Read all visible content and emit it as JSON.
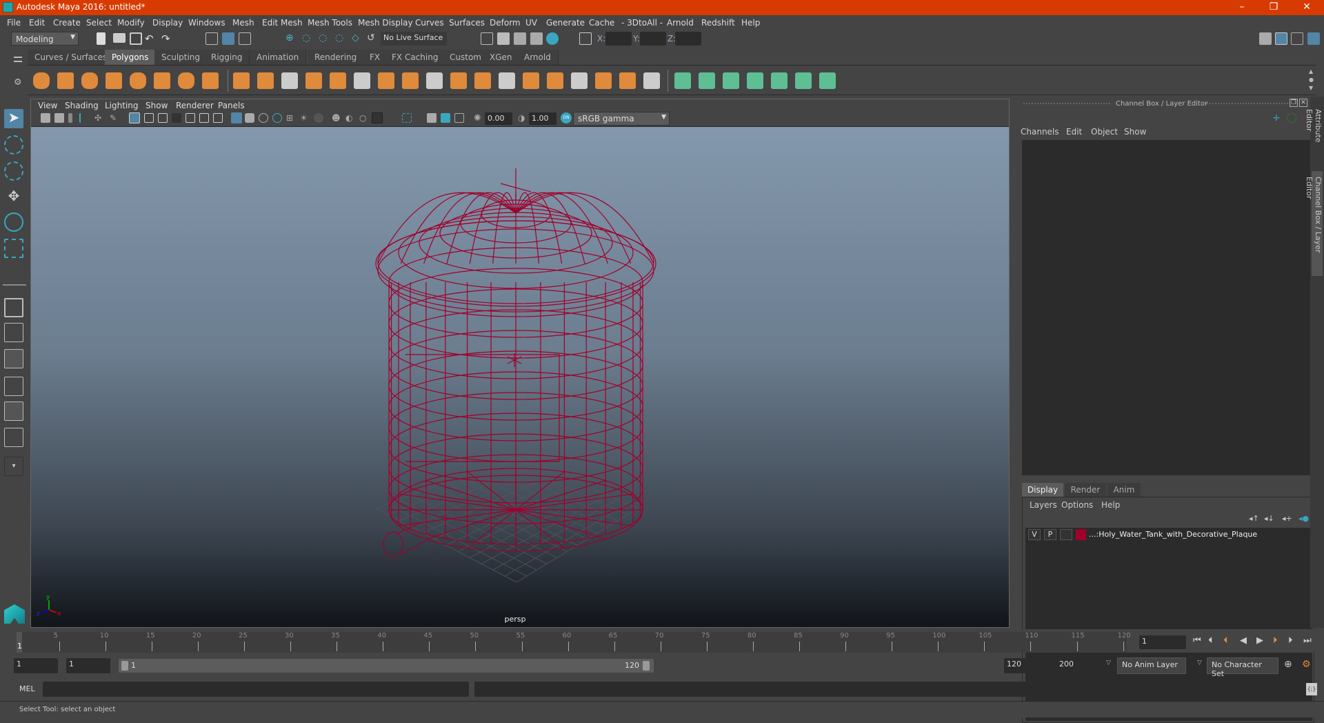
{
  "window": {
    "title": "Autodesk Maya 2016: untitled*",
    "minimize": "–",
    "restore": "❐",
    "close": "✕"
  },
  "menubar": [
    "File",
    "Edit",
    "Create",
    "Select",
    "Modify",
    "Display",
    "Windows",
    "Mesh",
    "Edit Mesh",
    "Mesh Tools",
    "Mesh Display",
    "Curves",
    "Surfaces",
    "Deform",
    "UV",
    "Generate",
    "Cache",
    "- 3DtoAll -",
    "Arnold",
    "Redshift",
    "Help"
  ],
  "statusline": {
    "mode": "Modeling",
    "live_surface": "No Live Surface",
    "x_label": "X:",
    "y_label": "Y:",
    "z_label": "Z:",
    "x_value": "",
    "y_value": "",
    "z_value": ""
  },
  "shelf": {
    "tabs": [
      "Curves / Surfaces",
      "Polygons",
      "Sculpting",
      "Rigging",
      "Animation",
      "Rendering",
      "FX",
      "FX Caching",
      "Custom",
      "XGen",
      "Arnold"
    ],
    "active_tab": "Polygons",
    "poly_icons": [
      "sphere-icon",
      "cube-icon",
      "cylinder-icon",
      "cone-icon",
      "plane-icon",
      "torus-icon",
      "pyramid-icon",
      "pipe-icon",
      "combine-icon",
      "separate-icon",
      "mirror-icon",
      "smooth-icon",
      "extrude-icon",
      "bevel-icon",
      "bridge-icon",
      "multi-cut-icon",
      "target-weld-icon",
      "edge-loop-icon",
      "merge-icon",
      "bool-icon",
      "fill-hole-icon",
      "insert-loop-icon",
      "offset-loop-icon",
      "wedge-icon",
      "poke-icon",
      "split-icon"
    ],
    "uv_icons": [
      "planar-uv-icon",
      "cylindrical-uv-icon",
      "spherical-uv-icon",
      "auto-uv-icon",
      "unfold-uv-icon",
      "uv-editor-icon",
      "uv-layout-icon"
    ],
    "accent_orange": "#e08a3c",
    "accent_green": "#5fbf94"
  },
  "viewport": {
    "menu": [
      "View",
      "Shading",
      "Lighting",
      "Show",
      "Renderer",
      "Panels"
    ],
    "near_value": "0.00",
    "gamma_value": "1.00",
    "colorspace": "sRGB gamma",
    "camera_label": "persp",
    "wire_color": "#a0002a",
    "axis": {
      "x": "x",
      "y": "y",
      "z": "z"
    }
  },
  "channel_box": {
    "title": "Channel Box / Layer Editor",
    "menu": [
      "Channels",
      "Edit",
      "Object",
      "Show"
    ],
    "layer_tabs": [
      "Display",
      "Render",
      "Anim"
    ],
    "active_layer_tab": "Display",
    "layer_menu": [
      "Layers",
      "Options",
      "Help"
    ],
    "layers": [
      {
        "visible": "V",
        "playback": "P",
        "type": "",
        "color": "#a0002a",
        "name": "...:Holy_Water_Tank_with_Decorative_Plaque"
      }
    ]
  },
  "side_tabs": [
    "Attribute Editor",
    "Channel Box / Layer Editor"
  ],
  "timeline": {
    "ticks": [
      "5",
      "10",
      "15",
      "20",
      "25",
      "30",
      "35",
      "40",
      "45",
      "50",
      "55",
      "60",
      "65",
      "70",
      "75",
      "80",
      "85",
      "90",
      "95",
      "100",
      "105",
      "110",
      "115",
      "120"
    ],
    "current_marker": "1",
    "current_frame": "1"
  },
  "range": {
    "start": "1",
    "playback_start": "1",
    "slider_start": "1",
    "slider_end": "120",
    "playback_end": "120",
    "end": "200",
    "anim_layer": "No Anim Layer",
    "character_set": "No Character Set"
  },
  "command_line": {
    "label": "MEL",
    "value": "",
    "result": ""
  },
  "help_line": "Select Tool: select an object"
}
